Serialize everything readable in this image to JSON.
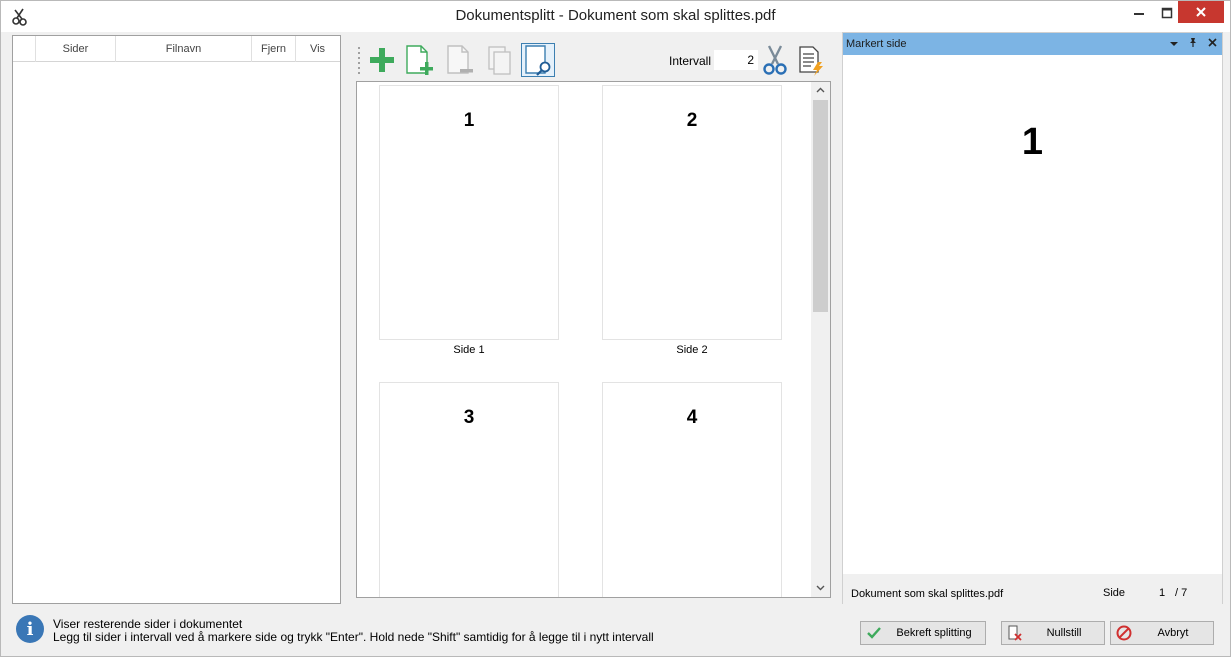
{
  "window": {
    "title": "Dokumentsplitt - Dokument som skal splittes.pdf"
  },
  "list": {
    "columns": [
      "Sider",
      "Filnavn",
      "Fjern",
      "Vis"
    ]
  },
  "toolbar": {
    "intervall_label": "Intervall",
    "intervall_value": "2",
    "icons": [
      "add-icon",
      "add-page-icon",
      "remove-page-icon",
      "copy-pages-icon",
      "page-zoom-icon",
      "scissors-icon",
      "document-flash-icon"
    ]
  },
  "thumbnails": [
    {
      "number": "1",
      "caption": "Side 1"
    },
    {
      "number": "2",
      "caption": "Side 2"
    },
    {
      "number": "3",
      "caption": ""
    },
    {
      "number": "4",
      "caption": ""
    }
  ],
  "preview": {
    "header": "Markert side",
    "page_number": "1",
    "filename": "Dokument som skal splittes.pdf",
    "side_label": "Side",
    "current_page": "1",
    "total_pages": "/ 7"
  },
  "status": {
    "line1": "Viser resterende sider i dokumentet",
    "line2": "Legg til sider i intervall ved å markere side og trykk \"Enter\". Hold nede \"Shift\" samtidig for å legge til i nytt intervall"
  },
  "actions": {
    "confirm": "Bekreft splitting",
    "reset": "Nullstill",
    "cancel": "Avbryt"
  },
  "colors": {
    "accent": "#7cb4e4",
    "close": "#c7372f",
    "green": "#3eaa5c",
    "info": "#3a77b6"
  }
}
